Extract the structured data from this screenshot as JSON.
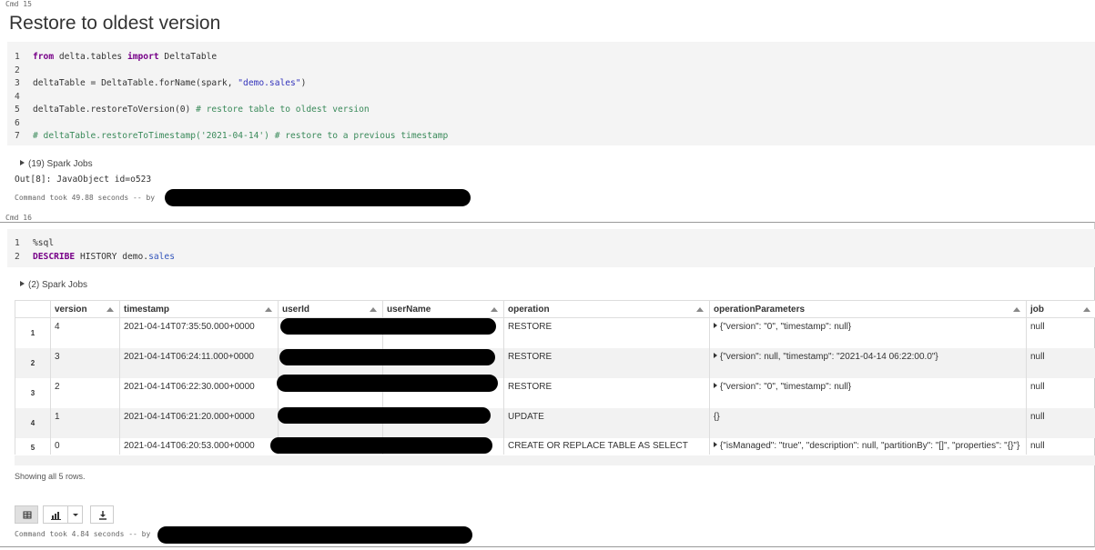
{
  "cmd15": {
    "label": "Cmd 15",
    "title": "Restore to oldest version",
    "code_lines": [
      {
        "n": "1",
        "parts": [
          {
            "t": "from",
            "c": "kw"
          },
          {
            "t": " delta.tables ",
            "c": ""
          },
          {
            "t": "import",
            "c": "kw"
          },
          {
            "t": " DeltaTable",
            "c": ""
          }
        ]
      },
      {
        "n": "2",
        "parts": []
      },
      {
        "n": "3",
        "parts": [
          {
            "t": "deltaTable = DeltaTable.forName(spark, ",
            "c": ""
          },
          {
            "t": "\"demo.sales\"",
            "c": "str"
          },
          {
            "t": ")",
            "c": ""
          }
        ]
      },
      {
        "n": "4",
        "parts": []
      },
      {
        "n": "5",
        "parts": [
          {
            "t": "deltaTable.restoreToVersion(0) ",
            "c": ""
          },
          {
            "t": "# restore table to oldest version",
            "c": "cmt"
          }
        ]
      },
      {
        "n": "6",
        "parts": []
      },
      {
        "n": "7",
        "parts": [
          {
            "t": "# deltaTable.restoreToTimestamp('2021-04-14') # restore to a previous timestamp",
            "c": "cmt"
          }
        ]
      }
    ],
    "spark_jobs": "(19) Spark Jobs",
    "output": "Out[8]: JavaObject id=o523",
    "took": "Command took 49.88 seconds -- by"
  },
  "cmd16": {
    "label": "Cmd 16",
    "code_lines": [
      {
        "n": "1",
        "parts": [
          {
            "t": "%sql",
            "c": ""
          }
        ]
      },
      {
        "n": "2",
        "parts": [
          {
            "t": "DESCRIBE",
            "c": "kw"
          },
          {
            "t": " HISTORY demo.",
            "c": ""
          },
          {
            "t": "sales",
            "c": "tbl"
          }
        ]
      }
    ],
    "spark_jobs": "(2) Spark Jobs",
    "table": {
      "columns": [
        "version",
        "timestamp",
        "userId",
        "userName",
        "operation",
        "operationParameters",
        "job"
      ],
      "rows": [
        {
          "idx": "1",
          "version": "4",
          "timestamp": "2021-04-14T07:35:50.000+0000",
          "operation": "RESTORE",
          "params": "{\"version\": \"0\", \"timestamp\": null}",
          "params_expandable": true,
          "job": "null"
        },
        {
          "idx": "2",
          "version": "3",
          "timestamp": "2021-04-14T06:24:11.000+0000",
          "operation": "RESTORE",
          "params": "{\"version\": null, \"timestamp\": \"2021-04-14 06:22:00.0\"}",
          "params_expandable": true,
          "job": "null"
        },
        {
          "idx": "3",
          "version": "2",
          "timestamp": "2021-04-14T06:22:30.000+0000",
          "operation": "RESTORE",
          "params": "{\"version\": \"0\", \"timestamp\": null}",
          "params_expandable": true,
          "job": "null"
        },
        {
          "idx": "4",
          "version": "1",
          "timestamp": "2021-04-14T06:21:20.000+0000",
          "operation": "UPDATE",
          "params": "{}",
          "params_expandable": false,
          "job": "null"
        },
        {
          "idx": "5",
          "version": "0",
          "timestamp": "2021-04-14T06:20:53.000+0000",
          "operation": "CREATE OR REPLACE TABLE AS SELECT",
          "params": "{\"isManaged\": \"true\", \"description\": null, \"partitionBy\": \"[]\", \"properties\": \"{}\"}",
          "params_expandable": true,
          "job": "null"
        }
      ]
    },
    "showing": "Showing all 5 rows.",
    "took": "Command took 4.84 seconds -- by",
    "view_buttons": {
      "table_icon": "table-icon",
      "chart_icon": "bar-chart-icon",
      "dropdown_icon": "chevron-down-icon",
      "download_icon": "download-icon"
    }
  }
}
